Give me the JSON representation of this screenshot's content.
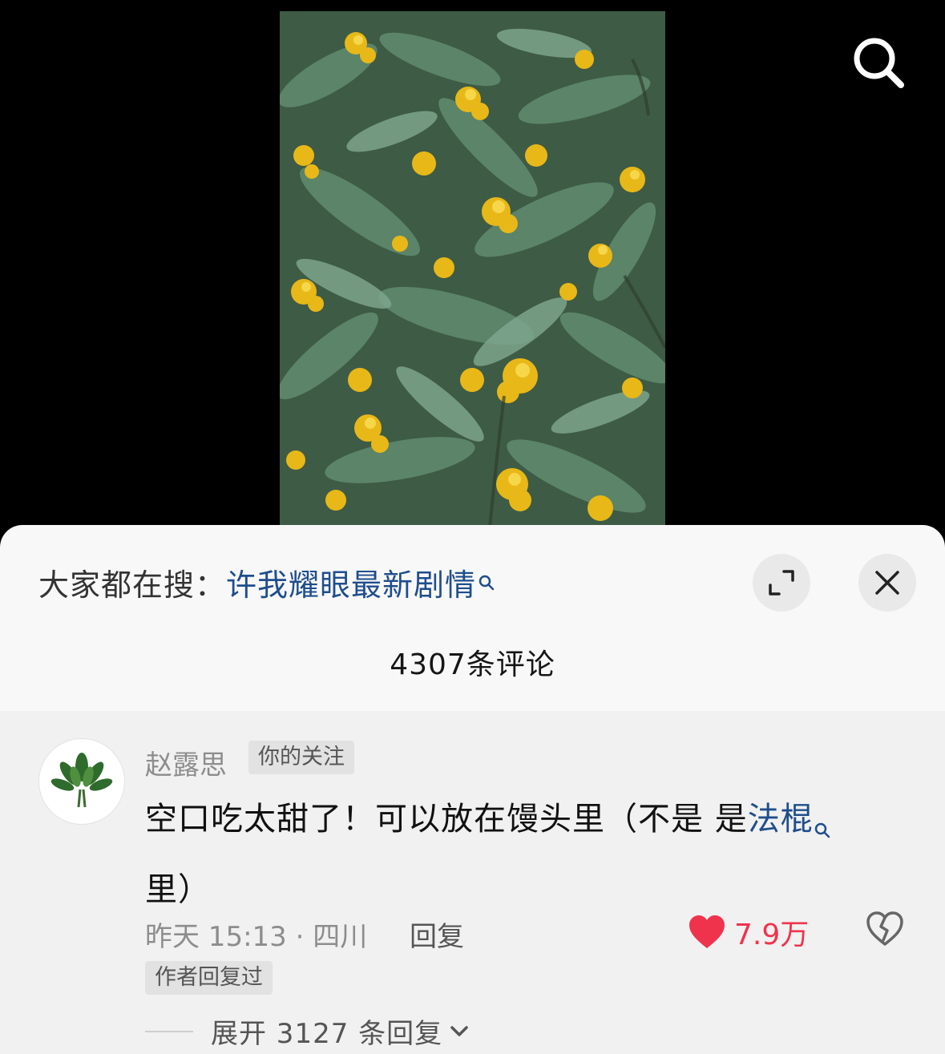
{
  "video": {
    "media": "osmanthus-flowers-video",
    "search_icon": "search-icon"
  },
  "comment_sheet": {
    "trending_prefix": "大家都在搜：",
    "trending_keyword": "许我耀眼最新剧情",
    "expand_icon": "expand-icon",
    "close_icon": "close-icon",
    "comment_count": "4307条评论"
  },
  "comment": {
    "username": "赵露思",
    "follow_tag": "你的关注",
    "text_before_link": "空口吃太甜了！可以放在馒头里（不是 是",
    "link_text": "法棍",
    "text_after_link": "里）",
    "meta": "昨天 15:13 · 四川",
    "reply_label": "回复",
    "likes": "7.9万",
    "author_tag": "作者回复过",
    "expand_label": "展开 3127 条回复"
  },
  "colors": {
    "link": "#1f4e8c",
    "like": "#f0334d"
  }
}
